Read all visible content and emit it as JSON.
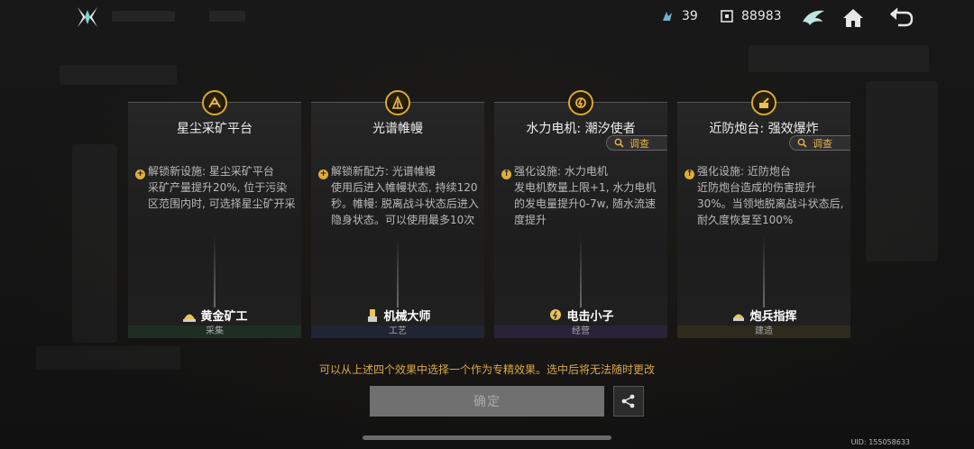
{
  "header": {
    "resource_a": {
      "icon": "crystal-icon",
      "value": "39"
    },
    "resource_b": {
      "icon": "chip-icon",
      "value": "88983"
    }
  },
  "cards": [
    {
      "icon": "mining-platform-icon",
      "title": "星尘采矿平台",
      "desc_first": "解锁新设施: 星尘采矿平台",
      "desc_rest": "采矿产量提升20%, 位于污染区范围内时, 可选择星尘矿开采",
      "hero": "黄金矿工",
      "category": "采集",
      "tag_color": "#1f2e22",
      "has_probe": false
    },
    {
      "icon": "spectrum-tent-icon",
      "title": "光谱帷幔",
      "desc_first": "解锁新配方: 光谱帷幔",
      "desc_rest": "使用后进入帷幔状态, 持续120秒。帷幔: 脱离战斗状态后进入隐身状态。可以使用最多10次",
      "hero": "机械大师",
      "category": "工艺",
      "tag_color": "#1f2533",
      "has_probe": false
    },
    {
      "icon": "generator-icon",
      "title": "水力电机: 潮汐使者",
      "probe": "调查",
      "desc_first": "强化设施: 水力电机",
      "desc_rest": "发电机数量上限+1, 水力电机的发电量提升0-7w, 随水流速度提升",
      "hero": "电击小子",
      "category": "经营",
      "tag_color": "#2a2238",
      "has_probe": true
    },
    {
      "icon": "turret-icon",
      "title": "近防炮台: 强效爆炸",
      "probe": "调查",
      "desc_first": "强化设施: 近防炮台",
      "desc_rest": "近防炮台造成的伤害提升30%。当领地脱离战斗状态后, 耐久度恢复至100%",
      "hero": "炮兵指挥",
      "category": "建造",
      "tag_color": "#2e2a1c",
      "has_probe": true
    }
  ],
  "footer": {
    "hint": "可以从上述四个效果中选择一个作为专精效果。选中后将无法随时更改",
    "confirm_label": "确定",
    "uid": "UID: 155058633"
  },
  "colors": {
    "accent": "#d9a84a",
    "gold": "#d9a832"
  }
}
